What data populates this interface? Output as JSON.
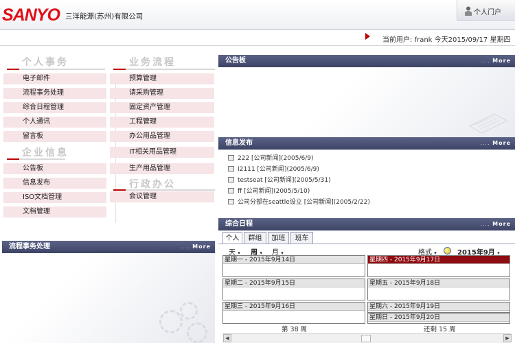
{
  "header": {
    "logo": "SANYO",
    "company": "三洋能源(苏州)有限公司",
    "portal_label": "个人门户"
  },
  "userbar": {
    "user_label": "当前用户:",
    "user_name": "frank",
    "today_text": "今天2015/09/17",
    "weekday": "星期四"
  },
  "left": {
    "personal_title": "个人事务",
    "personal_items": [
      "电子邮件",
      "流程事务处理",
      "综合日程管理",
      "个人通讯",
      "留言板"
    ],
    "corp_title": "企业信息",
    "corp_items": [
      "公告板",
      "信息发布",
      "ISO文档管理",
      "文档管理"
    ],
    "workflow_title": "业务流程",
    "workflow_items": [
      "预算管理",
      "请采购管理",
      "固定资产管理",
      "工程管理",
      "办公用品管理",
      "IT相关用品管理",
      "生产用品管理"
    ],
    "admin_title": "行政办公",
    "admin_items": [
      "会议管理"
    ],
    "flow_panel_title": "流程事务处理",
    "more_label": "More"
  },
  "right": {
    "board_title": "公告板",
    "info_title": "信息发布",
    "info_items": [
      "222 [公司新闻](2005/6/9)",
      "I2111 [公司新闻](2005/6/9)",
      "testseat [公司新闻](2005/5/31)",
      "ff [公司新闻](2005/5/10)",
      "公司分部在seattle设立 [公司新闻](2005/2/22)"
    ],
    "schedule_title": "综合日程",
    "tabs": [
      "个人",
      "群组",
      "加班",
      "班车"
    ],
    "views": [
      "天",
      "周",
      "月"
    ],
    "format_label": "格式",
    "month_label": "2015年9月",
    "days_left": [
      "星期一 - 2015年9月14日",
      "星期二 - 2015年9月15日",
      "星期三 - 2015年9月16日"
    ],
    "days_right": [
      "星期四 - 2015年9月17日",
      "星期五 - 2015年9月18日",
      "星期六 - 2015年9月19日",
      "星期日 - 2015年9月20日"
    ],
    "week_label": "第 38 周",
    "remaining_label": "还剩 15 周"
  },
  "colors": {
    "brand_red": "#e01018",
    "bar_navy": "#474e72",
    "menu_pink": "#f6e4e6",
    "today_red": "#8e0c10"
  }
}
